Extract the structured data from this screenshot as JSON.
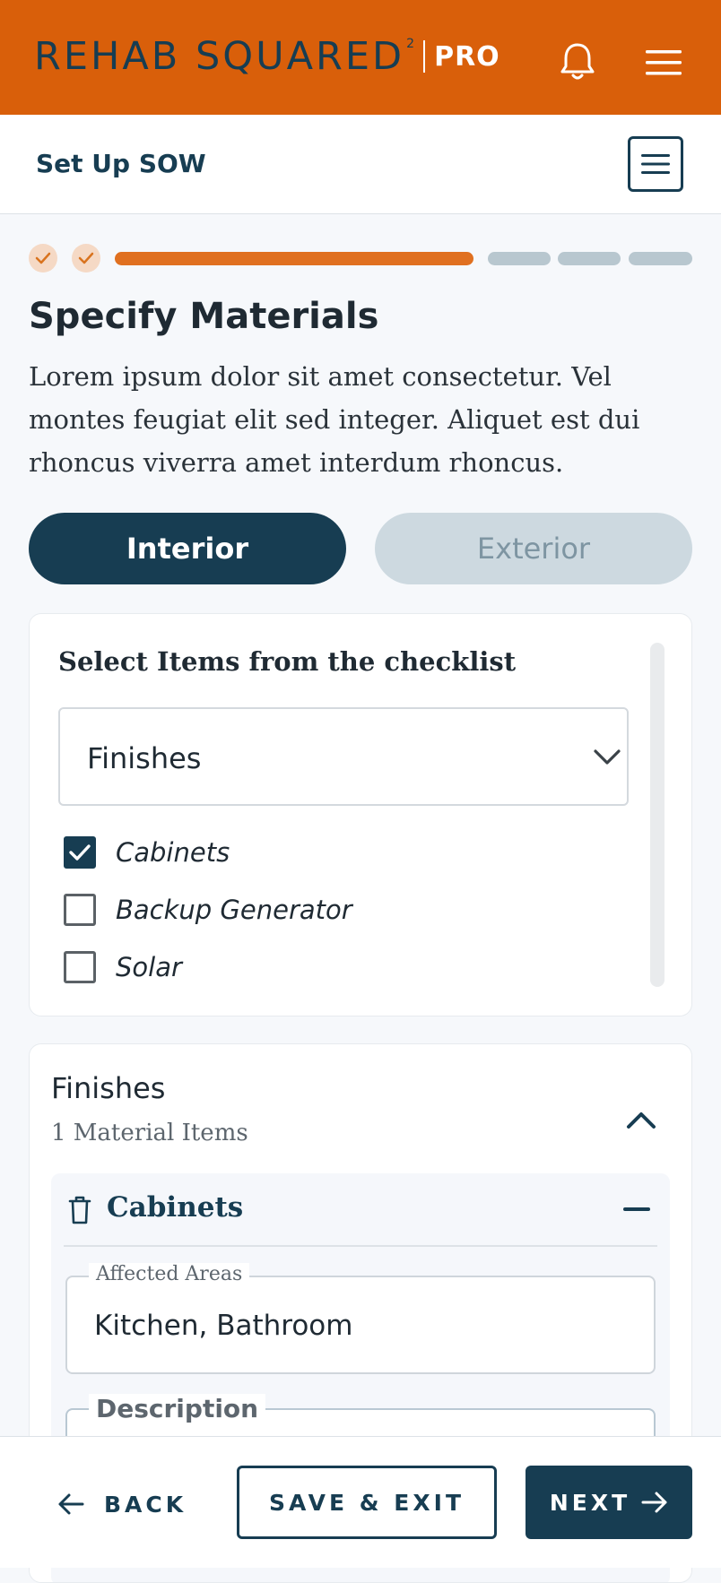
{
  "header": {
    "brand_name": "REHAB SQUARED",
    "brand_superscript": "2",
    "brand_badge": "PRO",
    "icons": [
      "bell-icon",
      "hamburger-menu-icon"
    ]
  },
  "subheader": {
    "title": "Set Up SOW",
    "menu_icon": "list-menu-icon"
  },
  "progress": {
    "completed_steps": 2,
    "current_step_fill": 1.0,
    "remaining_steps": 3,
    "accent_color": "#e07020",
    "inactive_color": "#b8c7cf"
  },
  "page": {
    "title": "Specify Materials",
    "intro": "Lorem ipsum dolor sit amet consectetur. Vel montes feugiat elit sed integer. Aliquet est dui rhoncus viverra amet interdum rhoncus."
  },
  "segmented": {
    "options": [
      {
        "label": "Interior",
        "selected": true
      },
      {
        "label": "Exterior",
        "selected": false
      }
    ]
  },
  "checklist": {
    "title": "Select Items from the checklist",
    "category_selected": "Finishes",
    "items": [
      {
        "label": "Cabinets",
        "checked": true
      },
      {
        "label": "Backup Generator",
        "checked": false
      },
      {
        "label": "Solar",
        "checked": false
      }
    ]
  },
  "section": {
    "title": "Finishes",
    "subtitle": "1 Material Items",
    "item": {
      "title": "Cabinets",
      "affected_areas_label": "Affected Areas",
      "affected_areas_value": "Kitchen, Bathroom",
      "description_label": "Description"
    }
  },
  "footer": {
    "back_label": "BACK",
    "save_label": "SAVE & EXIT",
    "next_label": "NEXT"
  },
  "colors": {
    "brand_orange": "#d95f0a",
    "primary_navy": "#173d52"
  }
}
